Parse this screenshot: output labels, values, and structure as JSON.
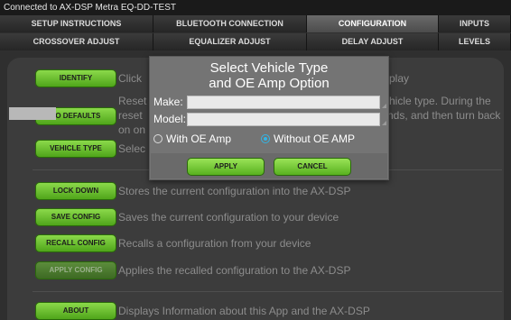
{
  "status_bar": {
    "text": "Connected to AX-DSP Metra EQ-DD-TEST"
  },
  "tabs_row1": [
    {
      "label": "SETUP INSTRUCTIONS"
    },
    {
      "label": "BLUETOOTH CONNECTION"
    },
    {
      "label": "CONFIGURATION"
    },
    {
      "label": "INPUTS"
    }
  ],
  "tabs_row2": [
    {
      "label": "CROSSOVER ADJUST"
    },
    {
      "label": "EQUALIZER ADJUST"
    },
    {
      "label": "DELAY ADJUST"
    },
    {
      "label": "LEVELS"
    }
  ],
  "active_tab": "CONFIGURATION",
  "config": {
    "identify": {
      "button": "IDENTIFY",
      "desc_left": "Click",
      "desc_right": "play"
    },
    "defaults": {
      "button": "TO DEFAULTS",
      "line1_left": "Reset",
      "line1_right": "hicle type. During the",
      "line2_left": "reset",
      "line2_right": "nds, and then turn back",
      "line3_left": "on on"
    },
    "vehicle": {
      "button": "VEHICLE TYPE",
      "desc_left": "Selec"
    },
    "lockdown": {
      "button": "LOCK DOWN",
      "desc": "Stores the current configuration into the AX-DSP"
    },
    "save": {
      "button": "SAVE CONFIG",
      "desc": "Saves the current configuration to your device"
    },
    "recall": {
      "button": "RECALL CONFIG",
      "desc": "Recalls a configuration from your device"
    },
    "apply_config": {
      "button": "APPLY CONFIG",
      "desc": "Applies the recalled configuration to the AX-DSP"
    },
    "about": {
      "button": "ABOUT",
      "desc": "Displays Information about this App and the AX-DSP"
    }
  },
  "dialog": {
    "title_line1": "Select Vehicle Type",
    "title_line2": "and OE Amp Option",
    "make_label": "Make:",
    "make_value": "",
    "model_label": "Model:",
    "model_value": "",
    "options": [
      {
        "label": "With OE Amp",
        "selected": false
      },
      {
        "label": "Without OE AMP",
        "selected": true
      }
    ],
    "apply": "APPLY",
    "cancel": "CANCEL"
  },
  "colors": {
    "accent_green": "#6cc232",
    "radio_selected": "#33b5e5"
  }
}
